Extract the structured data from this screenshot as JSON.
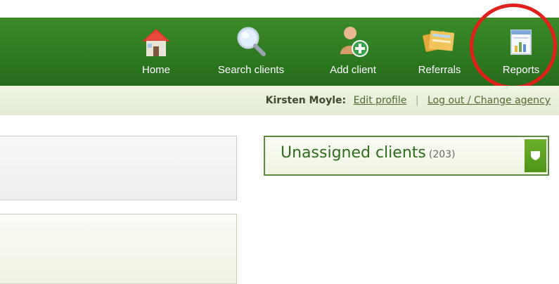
{
  "nav": {
    "items": [
      {
        "label": "Home",
        "icon": "home-icon"
      },
      {
        "label": "Search clients",
        "icon": "search-icon"
      },
      {
        "label": "Add client",
        "icon": "add-user-icon"
      },
      {
        "label": "Referrals",
        "icon": "referrals-icon"
      },
      {
        "label": "Reports",
        "icon": "reports-icon"
      }
    ]
  },
  "user": {
    "name": "Kirsten Moyle:",
    "edit_profile": "Edit profile",
    "separator": "|",
    "logout": "Log out / Change agency"
  },
  "unassigned": {
    "title": "Unassigned clients",
    "count": "(203)"
  },
  "colors": {
    "nav_green": "#2f7a22",
    "highlight_circle": "#e0201a",
    "dropdown_green": "#5fa322"
  }
}
